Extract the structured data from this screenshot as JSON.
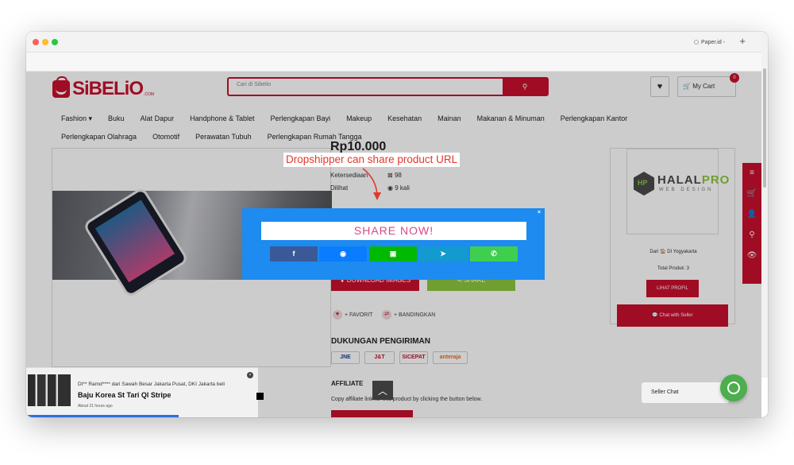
{
  "browser": {
    "tab_title": "Paper.id - ",
    "new_tab_symbol": "+"
  },
  "site": {
    "logo_text": "SiBELiO",
    "logo_suffix": ".COM",
    "search_placeholder": "Cari di Sibelio",
    "search_button_icon": "search-icon",
    "cart_label": "My Cart",
    "cart_count": "0"
  },
  "nav": {
    "row1": [
      "Fashion ▾",
      "Buku",
      "Alat Dapur",
      "Handphone & Tablet",
      "Perlengkapan Bayi",
      "Makeup",
      "Kesehatan",
      "Mainan",
      "Makanan & Minuman",
      "Perlengkapan Kantor"
    ],
    "row2": [
      "Perlengkapan Olahraga",
      "Otomotif",
      "Perawatan Tubuh",
      "Perlengkapan Rumah Tangga"
    ]
  },
  "product": {
    "price": "Rp10.000",
    "stock_label": "Ketersediaan",
    "stock_value": "98",
    "seen_label": "Dilihat",
    "seen_value": "9 kali",
    "download_label": "DOWNLOAD IMAGES",
    "share_label": "SHARE",
    "favorit_label": "+ FAVORIT",
    "compare_label": "+ BANDINGKAN",
    "shipping_heading": "DUKUNGAN PENGIRIMAN",
    "couriers": [
      "JNE",
      "J&T",
      "SICEPAT",
      "anteraja"
    ],
    "affiliate_heading": "AFFILIATE",
    "affiliate_desc": "Copy affiliate link for this product by clicking the button below."
  },
  "seller": {
    "brand_main": "HALAL",
    "brand_accent": "PRO",
    "brand_sub": "WEB DESIGN",
    "location": "Dari 🏠 DI Yogyakarta",
    "total_products": "Total Produk: 3",
    "profile_button": "LIHAT PROFIL",
    "chat_button": "Chat with Seller"
  },
  "notification": {
    "line1": "DI** Ramd**** dari Sawah Besar Jakarta Pusat, DKI Jakarta beli",
    "product": "Baju Korea St Tari Ql Stripe",
    "time": "About 21 hours ago"
  },
  "seller_chat_label": "Seller Chat",
  "annotation": "Dropshipper can share product URL",
  "modal": {
    "title": "SHARE NOW!",
    "close": "×",
    "buttons": [
      {
        "name": "facebook",
        "glyph": "f",
        "color": "#3b5998"
      },
      {
        "name": "messenger",
        "glyph": "◉",
        "color": "#0a7cff"
      },
      {
        "name": "line",
        "glyph": "▣",
        "color": "#00b900"
      },
      {
        "name": "telegram",
        "glyph": "➤",
        "color": "#139bd0"
      },
      {
        "name": "whatsapp",
        "glyph": "✆",
        "color": "#3ecf4f"
      }
    ]
  },
  "colors": {
    "brand_red": "#c8102e",
    "modal_blue": "#1d8bf0",
    "annotation_red": "#e0392b"
  }
}
